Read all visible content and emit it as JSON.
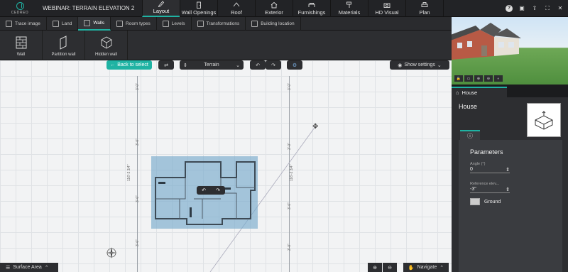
{
  "app": {
    "logo_text": "CEDREO",
    "title": "WEBINAR: TERRAIN ELEVATION 2"
  },
  "main_tabs": [
    {
      "label": "Layout",
      "icon": "pencil-icon",
      "active": true
    },
    {
      "label": "Wall Openings",
      "icon": "door-icon",
      "active": false
    },
    {
      "label": "Roof",
      "icon": "roof-icon",
      "active": false
    },
    {
      "label": "Exterior",
      "icon": "exterior-icon",
      "active": false
    },
    {
      "label": "Furnishings",
      "icon": "sofa-icon",
      "active": false
    },
    {
      "label": "Materials",
      "icon": "paint-roller-icon",
      "active": false
    },
    {
      "label": "HD Visual",
      "icon": "camera-icon",
      "active": false
    },
    {
      "label": "Plan",
      "icon": "printer-icon",
      "active": false
    }
  ],
  "top_actions": [
    "help-icon",
    "save-icon",
    "share-icon",
    "fullscreen-icon",
    "close-icon"
  ],
  "sub_tabs": [
    {
      "label": "Trace image",
      "active": false
    },
    {
      "label": "Land",
      "active": false
    },
    {
      "label": "Walls",
      "active": true
    },
    {
      "label": "Room types",
      "active": false
    },
    {
      "label": "Levels",
      "active": false
    },
    {
      "label": "Transformations",
      "active": false
    },
    {
      "label": "Building location",
      "active": false
    }
  ],
  "tools": [
    {
      "label": "Wall"
    },
    {
      "label": "Partition wall"
    },
    {
      "label": "Hidden wall"
    }
  ],
  "canvas": {
    "back_label": "Back to select",
    "layer_value": "Terrain",
    "show_settings": "Show settings",
    "dim_labels": [
      "3'-0\"",
      "3'-0\"",
      "3'-0\"",
      "3'-0\"",
      "3'-0\"",
      "3'-0\"",
      "3'-0\"",
      "3'-0\""
    ],
    "plan_side_left": "116'-2 3/4\"",
    "plan_side_right": "116'-2 3/4\"",
    "bottom_left_label": "Surface Area",
    "navigate_label": "Navigate"
  },
  "panel": {
    "tab_label": "House",
    "title": "House",
    "section_title": "Parameters",
    "fields": [
      {
        "label": "Angle (°)",
        "value": "0"
      },
      {
        "label": "Reference elev...",
        "value": "-3\""
      }
    ],
    "ground_label": "Ground"
  },
  "colors": {
    "accent": "#1fb3a3",
    "plan_fill": "#78aacd",
    "panel_bg": "#2d2e31"
  }
}
